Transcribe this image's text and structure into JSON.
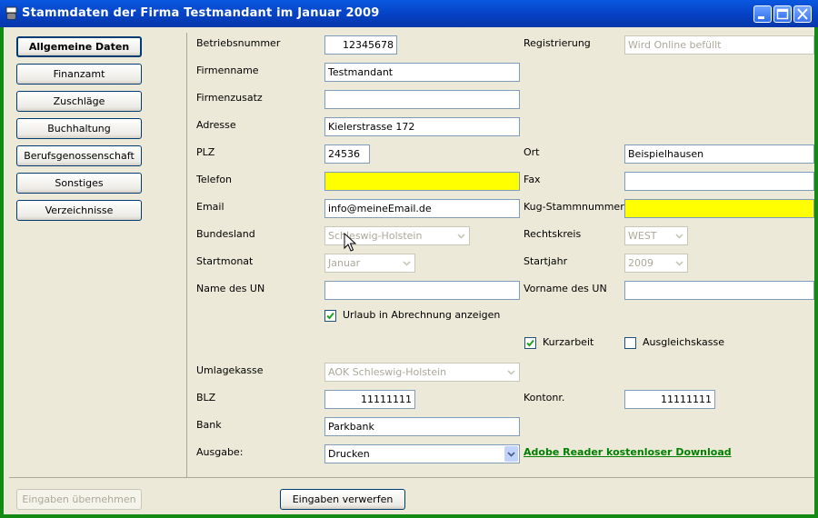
{
  "window": {
    "title": "Stammdaten der Firma Testmandant im Januar 2009",
    "icons": [
      "app-icon",
      "minimize-icon",
      "maximize-icon",
      "close-icon"
    ]
  },
  "nav": {
    "items": [
      {
        "label": "Allgemeine Daten",
        "active": true
      },
      {
        "label": "Finanzamt"
      },
      {
        "label": "Zuschläge"
      },
      {
        "label": "Buchhaltung"
      },
      {
        "label": "Berufsgenossenschaft"
      },
      {
        "label": "Sonstiges"
      },
      {
        "label": "Verzeichnisse"
      }
    ]
  },
  "form": {
    "betriebsnummer": {
      "label": "Betriebsnummer",
      "value": "12345678"
    },
    "registrierung": {
      "label": "Registrierung",
      "value": "Wird Online befüllt"
    },
    "firmenname": {
      "label": "Firmenname",
      "value": "Testmandant"
    },
    "firmenzusatz": {
      "label": "Firmenzusatz",
      "value": ""
    },
    "adresse": {
      "label": "Adresse",
      "value": "Kielerstrasse 172"
    },
    "plz": {
      "label": "PLZ",
      "value": "24536"
    },
    "ort": {
      "label": "Ort",
      "value": "Beispielhausen"
    },
    "telefon": {
      "label": "Telefon",
      "value": ""
    },
    "fax": {
      "label": "Fax",
      "value": ""
    },
    "email": {
      "label": "Email",
      "value": "info@meineEmail.de"
    },
    "kug": {
      "label": "Kug-Stammnummer",
      "value": ""
    },
    "bundesland": {
      "label": "Bundesland",
      "value": "Schleswig-Holstein"
    },
    "rechtskreis": {
      "label": "Rechtskreis",
      "value": "WEST"
    },
    "startmonat": {
      "label": "Startmonat",
      "value": "Januar"
    },
    "startjahr": {
      "label": "Startjahr",
      "value": "2009"
    },
    "name_un": {
      "label": "Name des UN",
      "value": ""
    },
    "vorname_un": {
      "label": "Vorname des UN",
      "value": ""
    },
    "urlaub": {
      "label": "Urlaub in Abrechnung anzeigen",
      "checked": true
    },
    "kurzarbeit": {
      "label": "Kurzarbeit",
      "checked": true
    },
    "ausgleichskasse": {
      "label": "Ausgleichskasse",
      "checked": false
    },
    "umlagekasse": {
      "label": "Umlagekasse",
      "value": "AOK Schleswig-Holstein"
    },
    "blz": {
      "label": "BLZ",
      "value": "11111111"
    },
    "kontonr": {
      "label": "Kontonr.",
      "value": "11111111"
    },
    "bank": {
      "label": "Bank",
      "value": "Parkbank"
    },
    "ausgabe": {
      "label": "Ausgabe:",
      "value": "Drucken"
    },
    "adobe_link": "Adobe Reader kostenloser Download"
  },
  "footer": {
    "apply": "Eingaben übernehmen",
    "discard": "Eingaben verwerfen"
  },
  "colors": {
    "titlebar": "#0541c4",
    "required_field": "#ffff00",
    "link": "#008000",
    "frame": "#138a13"
  }
}
